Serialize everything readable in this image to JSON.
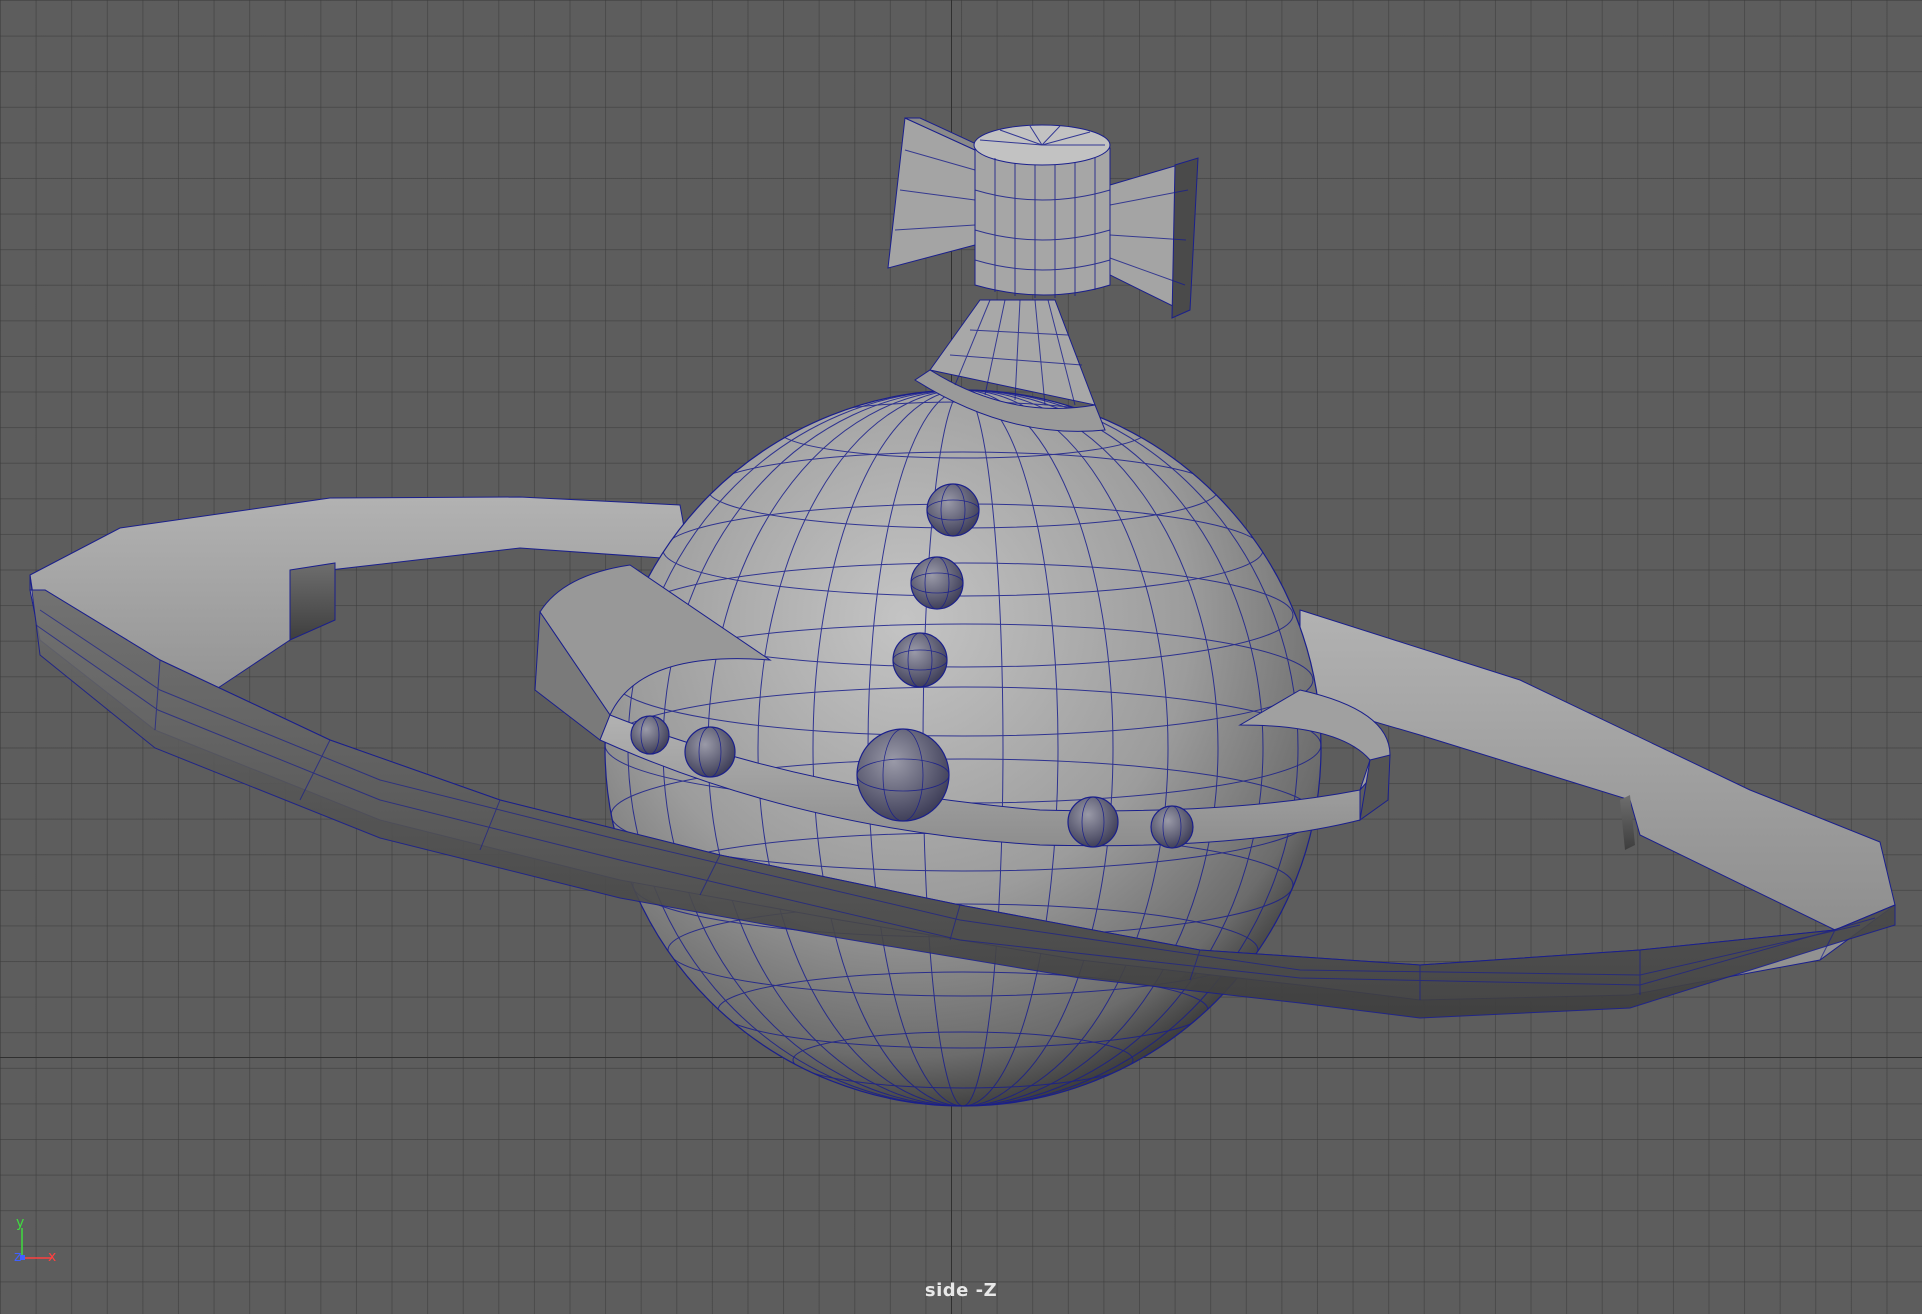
{
  "viewport": {
    "camera_label": "side -Z",
    "background_color": "#5d5d5d",
    "grid_color": "#3c3c3c",
    "wireframe_color": "#1a1f8c",
    "object": "orb-with-ring"
  },
  "axis_gizmo": {
    "y_label": "y",
    "z_label": "z",
    "x_label": "x",
    "y_color": "#3fdc3f",
    "z_color": "#4060ff",
    "x_color": "#ff4040"
  }
}
